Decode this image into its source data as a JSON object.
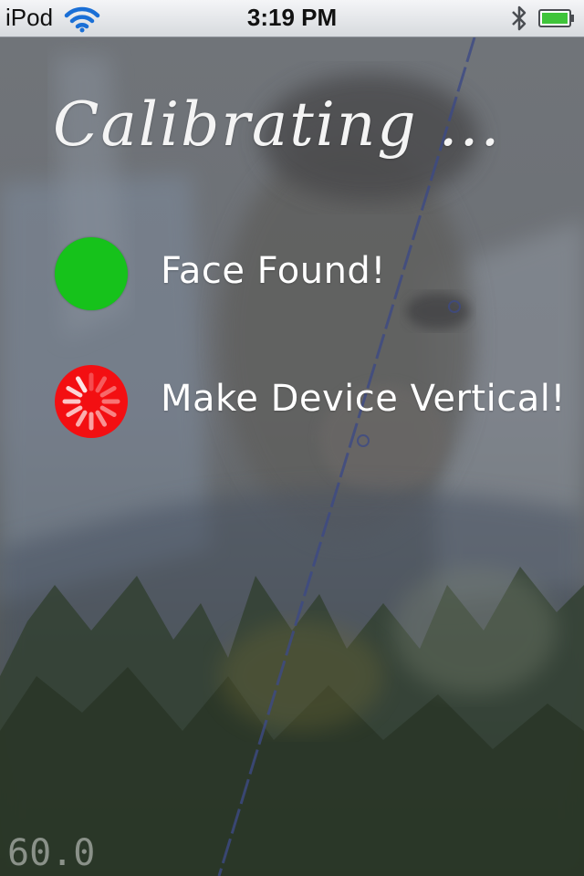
{
  "status_bar": {
    "carrier": "iPod",
    "time": "3:19 PM",
    "icons": [
      "wifi-icon",
      "bluetooth-icon",
      "battery-icon"
    ],
    "battery_color": "#3fc43a"
  },
  "overlay": {
    "title": "Calibrating ...",
    "checks": [
      {
        "label": "Face Found!",
        "state": "done",
        "indicator": "green-dot",
        "color": "#16c21b"
      },
      {
        "label": "Make Device Vertical!",
        "state": "in-progress",
        "indicator": "red-spinner",
        "color": "#f30f12"
      }
    ],
    "fps_readout": "60.0"
  }
}
